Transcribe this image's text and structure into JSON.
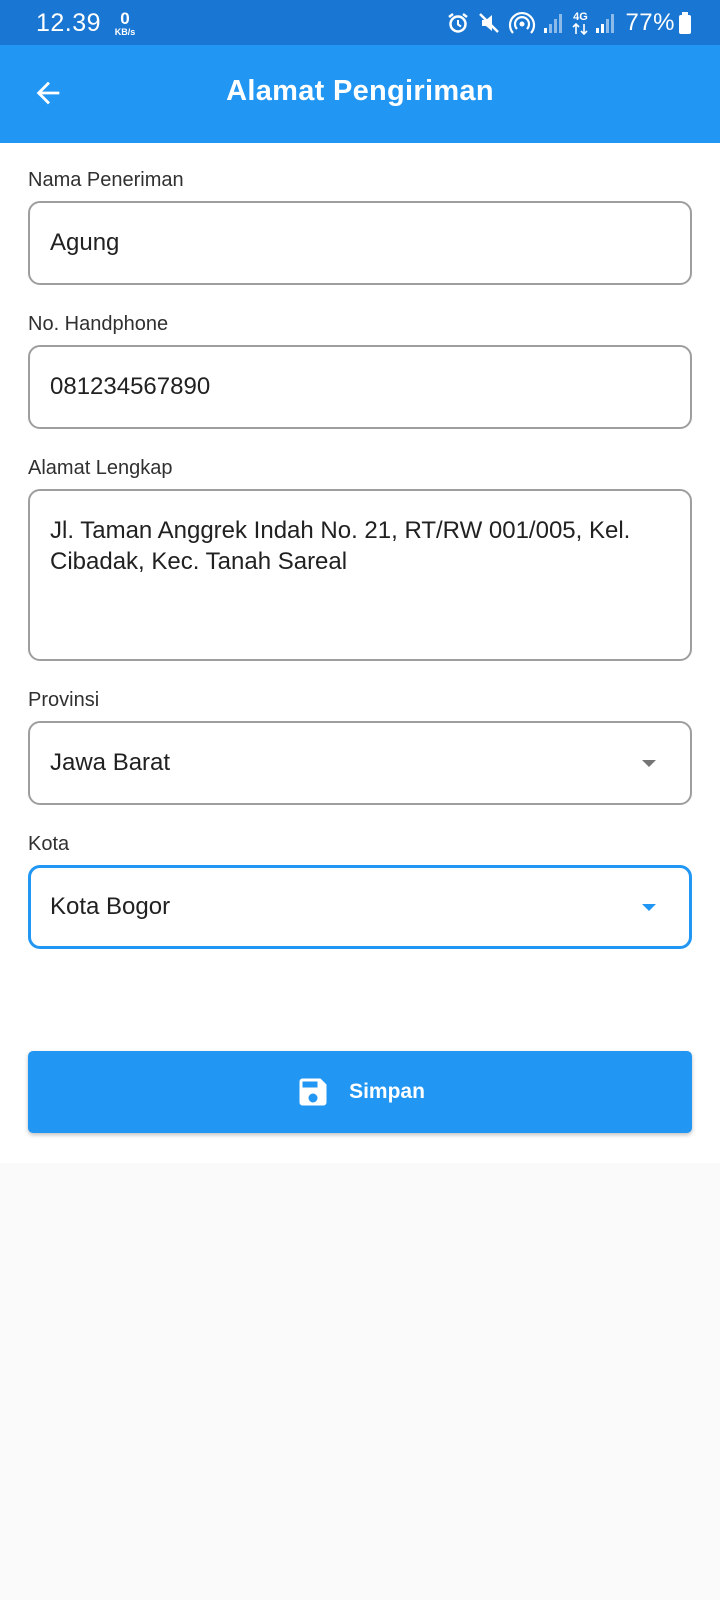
{
  "status_bar": {
    "time": "12.39",
    "net_speed_value": "0",
    "net_speed_unit": "KB/s",
    "network_label": "4G",
    "battery": "77%",
    "icons": [
      "alarm-icon",
      "mute-icon",
      "hotspot-icon",
      "signal-icon",
      "data-arrows-icon",
      "signal-icon",
      "battery-icon"
    ]
  },
  "app_bar": {
    "title": "Alamat Pengiriman",
    "back_icon": "arrow-back-icon"
  },
  "form": {
    "nama": {
      "label": "Nama Peneriman",
      "value": "Agung"
    },
    "phone": {
      "label": "No. Handphone",
      "value": "081234567890"
    },
    "alamat": {
      "label": "Alamat Lengkap",
      "value": "Jl. Taman Anggrek Indah No. 21, RT/RW 001/005, Kel. Cibadak, Kec. Tanah Sareal"
    },
    "provinsi": {
      "label": "Provinsi",
      "value": "Jawa Barat"
    },
    "kota": {
      "label": "Kota",
      "value": "Kota Bogor"
    }
  },
  "save_button": {
    "label": "Simpan",
    "icon": "save-icon"
  },
  "colors": {
    "primary": "#2196f3",
    "status_bar": "#1976d2",
    "field_border": "#9e9e9e",
    "focus_border": "#2196f3"
  }
}
